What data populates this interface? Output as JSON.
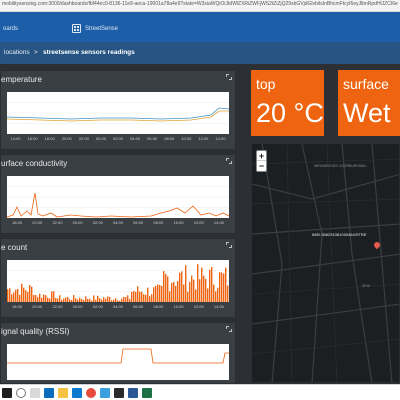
{
  "browser": {
    "address": "mobilitysensing.com:3000/dashboards/fbf44ec0-8136-11e9-aeca-19001a78a4e9?state=W3siaWQiOiJtdWlZXRiZWFjWS2tZiZjQ29sbGVjdGlvbiIsInBhcmFtcyI6eyJlbnRpdHlJZCI6eyJlbnRpdHlUeXBl..."
  },
  "toolbar": {
    "items": [
      "oards",
      "StreetSense"
    ]
  },
  "breadcrumb": {
    "items": [
      "locations",
      ">",
      "streetsense sensors readings"
    ]
  },
  "panels": [
    {
      "title": "emperature"
    },
    {
      "title": "urface conductivity"
    },
    {
      "title": "e count"
    },
    {
      "title": "ignal quality (RSSI)"
    }
  ],
  "tiles": [
    {
      "label": "top",
      "value": "20 °C"
    },
    {
      "label": "surface",
      "value": "Wet"
    }
  ],
  "map": {
    "zoom_in": "+",
    "zoom_out": "−",
    "marker_label": "IMEI:356291081093464/STRE",
    "street_labels": [
      "NIEUWEZIJDS VOORBURGWAL",
      "SPUI"
    ]
  },
  "axis_ticks": {
    "temperature": [
      "14:00",
      "16:00",
      "18:00",
      "20:00",
      "22:00",
      "00:00",
      "02:00",
      "04:00",
      "06:00",
      "08:00",
      "10:00",
      "12:00",
      "14:00"
    ],
    "conductivity": [
      "18:00",
      "20:00",
      "22:00",
      "00:00",
      "02:00",
      "04:00",
      "06:00",
      "08:00",
      "10:00",
      "12:00",
      "14:00"
    ],
    "count": [
      "18:00",
      "20:00",
      "22:00",
      "00:00",
      "02:00",
      "04:00",
      "06:00",
      "08:00",
      "10:00",
      "12:00",
      "14:00"
    ]
  },
  "colors": {
    "accent_orange": "#ee6411",
    "toolbar_blue": "#1d5ea8",
    "breadcrumb_blue": "#275482",
    "panel_bg": "#3a3f44",
    "line_blue": "#3f93c9",
    "line_amber": "#e1a531"
  },
  "icons": [
    "dashboard-icon",
    "expand-icon",
    "map-marker-icon",
    "windows-start-icon",
    "search-icon",
    "edge-icon",
    "folder-icon",
    "store-icon",
    "mail-icon",
    "chrome-icon",
    "terminal-icon",
    "word-icon",
    "excel-icon"
  ]
}
